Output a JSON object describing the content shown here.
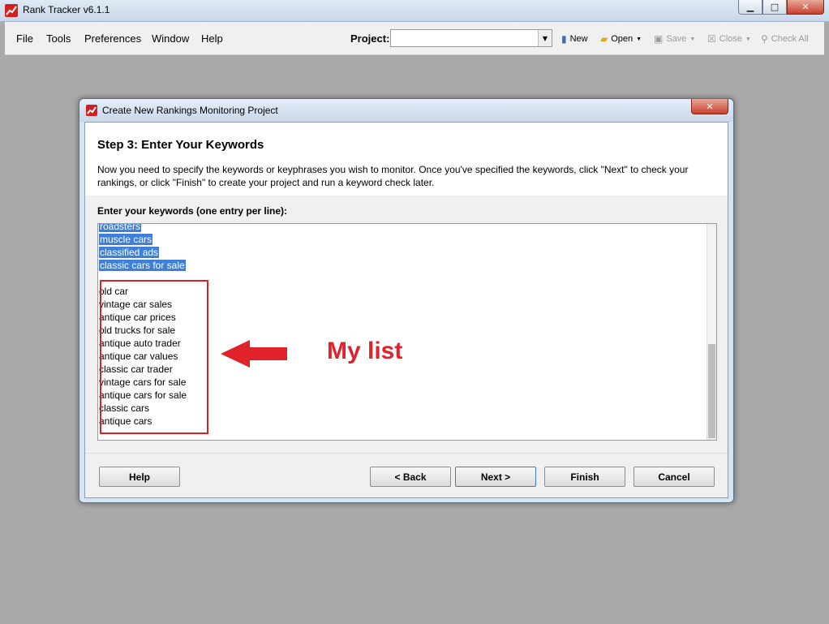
{
  "app": {
    "title": "Rank Tracker v6.1.1"
  },
  "window_controls": {
    "minimize": "▁",
    "maximize": "□",
    "close": "✕"
  },
  "menubar": {
    "items": [
      {
        "label": "File"
      },
      {
        "label": "Tools"
      },
      {
        "label": "Preferences"
      },
      {
        "label": "Window"
      },
      {
        "label": "Help"
      }
    ]
  },
  "toolbar": {
    "project_label": "Project:",
    "project_value": "",
    "new_label": "New",
    "open_label": "Open",
    "save_label": "Save",
    "close_label": "Close",
    "check_all_label": "Check All"
  },
  "dialog": {
    "title": "Create New Rankings Monitoring Project",
    "close": "✕",
    "step_title": "Step 3: Enter Your Keywords",
    "description": "Now you need to specify the keywords or keyphrases you wish to monitor. Once you've specified the keywords, click \"Next\" to check your rankings, or click \"Finish\" to create your project and run a keyword check later.",
    "keywords_label": "Enter your keywords (one entry per line):",
    "selected_keywords": [
      "roadsters",
      "muscle cars",
      "classified ads",
      "classic cars for sale"
    ],
    "my_keywords": [
      "old car",
      "vintage car sales",
      "antique car prices",
      "old trucks for sale",
      "antique auto trader",
      "antique car values",
      "classic car trader",
      "vintage cars for sale",
      "antique cars for sale",
      "classic cars",
      "antique cars"
    ],
    "annotation_text": "My list",
    "annotation_color": "#e0232b",
    "buttons": {
      "help": "Help",
      "back": "< Back",
      "next": "Next >",
      "finish": "Finish",
      "cancel": "Cancel"
    }
  }
}
